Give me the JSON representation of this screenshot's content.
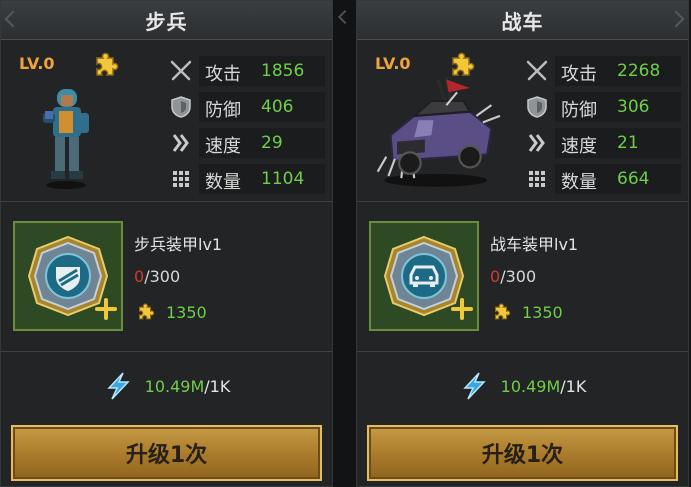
{
  "panels": [
    {
      "title": "步兵",
      "level": "LV.0",
      "unit": "infantry-soldier",
      "stats": {
        "attack": {
          "label": "攻击",
          "value": "1856"
        },
        "defense": {
          "label": "防御",
          "value": "406"
        },
        "speed": {
          "label": "速度",
          "value": "29"
        },
        "count": {
          "label": "数量",
          "value": "1104"
        }
      },
      "equipment": {
        "name": "步兵装甲lv1",
        "current": "0",
        "max": "/300",
        "cost": "1350",
        "icon": "infantry-armor-icon"
      },
      "power": {
        "value": "10.49M",
        "max": "/1K"
      },
      "upgrade_label": "升级1次"
    },
    {
      "title": "战车",
      "level": "LV.0",
      "unit": "war-truck",
      "stats": {
        "attack": {
          "label": "攻击",
          "value": "2268"
        },
        "defense": {
          "label": "防御",
          "value": "306"
        },
        "speed": {
          "label": "速度",
          "value": "21"
        },
        "count": {
          "label": "数量",
          "value": "664"
        }
      },
      "equipment": {
        "name": "战车装甲lv1",
        "current": "0",
        "max": "/300",
        "cost": "1350",
        "icon": "vehicle-armor-icon"
      },
      "power": {
        "value": "10.49M",
        "max": "/1K"
      },
      "upgrade_label": "升级1次"
    }
  ],
  "colors": {
    "stat_value": "#6fce4a",
    "level": "#f1a23a",
    "progress_current": "#d23b2f",
    "button": "#b8893a"
  }
}
